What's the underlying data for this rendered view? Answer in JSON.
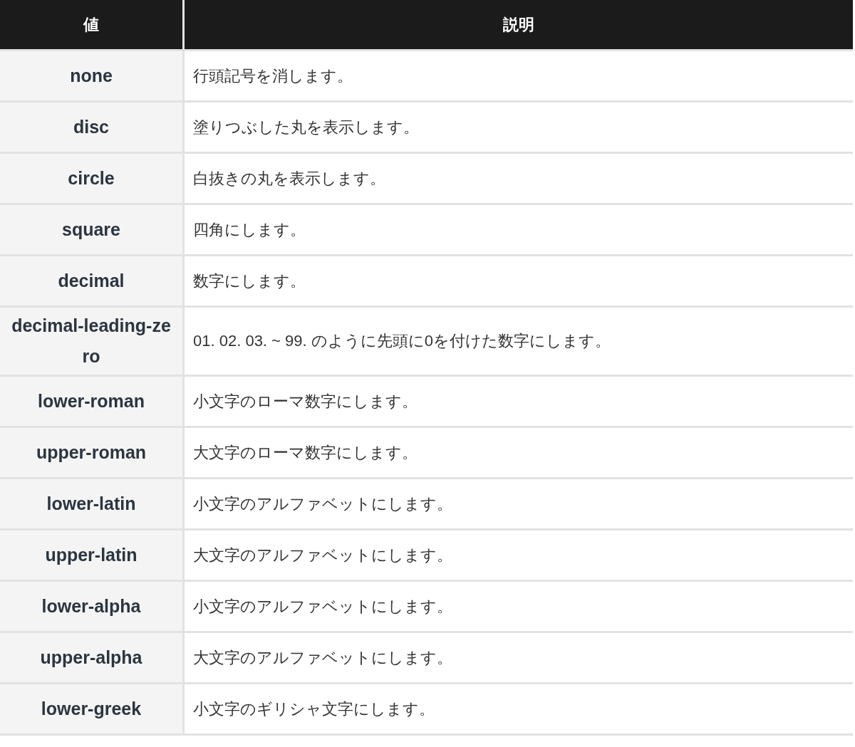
{
  "table": {
    "columns": [
      "値",
      "説明"
    ],
    "rows": [
      {
        "value": "none",
        "description": "行頭記号を消します。"
      },
      {
        "value": "disc",
        "description": "塗りつぶした丸を表示します。"
      },
      {
        "value": "circle",
        "description": "白抜きの丸を表示します。"
      },
      {
        "value": "square",
        "description": "四角にします。"
      },
      {
        "value": "decimal",
        "description": "数字にします。"
      },
      {
        "value": "decimal-leading-zero",
        "description": "01. 02. 03. ~ 99. のように先頭に0を付けた数字にします。"
      },
      {
        "value": "lower-roman",
        "description": "小文字のローマ数字にします。"
      },
      {
        "value": "upper-roman",
        "description": "大文字のローマ数字にします。"
      },
      {
        "value": "lower-latin",
        "description": "小文字のアルファベットにします。"
      },
      {
        "value": "upper-latin",
        "description": "大文字のアルファベットにします。"
      },
      {
        "value": "lower-alpha",
        "description": "小文字のアルファベットにします。"
      },
      {
        "value": "upper-alpha",
        "description": "大文字のアルファベットにします。"
      },
      {
        "value": "lower-greek",
        "description": "小文字のギリシャ文字にします。"
      }
    ]
  }
}
